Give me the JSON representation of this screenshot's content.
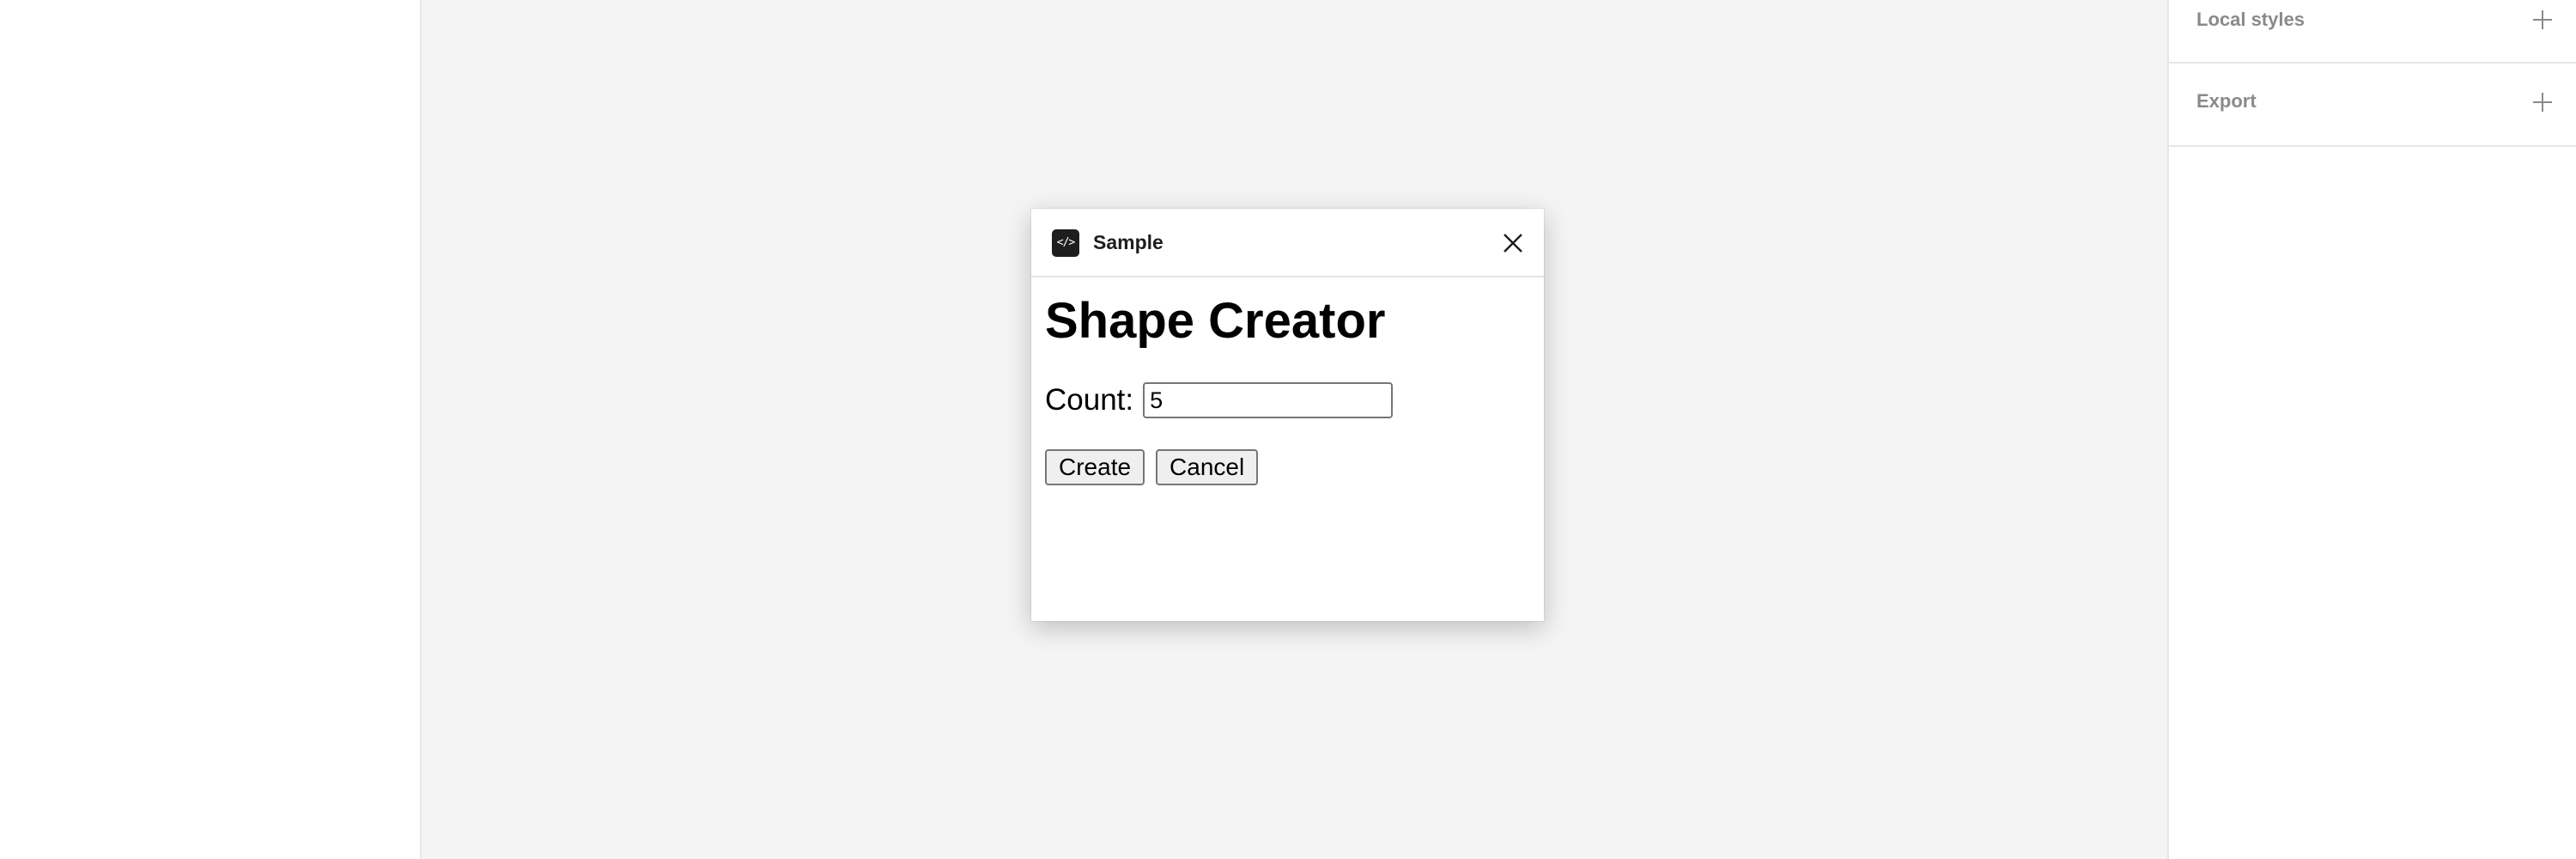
{
  "right_panel": {
    "sections": [
      {
        "label": "Local styles",
        "icon": "plus-icon"
      },
      {
        "label": "Export",
        "icon": "plus-icon"
      }
    ]
  },
  "dialog": {
    "plugin_icon_glyph": "</>",
    "title": "Sample",
    "close_icon": "close-icon",
    "heading": "Shape Creator",
    "count_label": "Count:",
    "count_value": "5",
    "create_label": "Create",
    "cancel_label": "Cancel"
  }
}
